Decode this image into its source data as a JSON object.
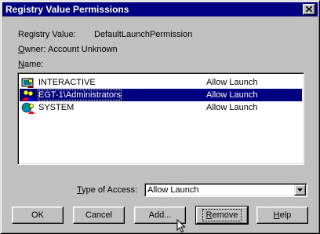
{
  "window": {
    "title": "Registry Value Permissions"
  },
  "fields": {
    "registry_value_label": "Registry Value:",
    "registry_value": "DefaultLaunchPermission",
    "owner_label_underlined": "O",
    "owner_label_rest": "wner:",
    "owner_value": "Account Unknown",
    "name_label_underlined": "N",
    "name_label_rest": "ame:"
  },
  "permissions": [
    {
      "name": "INTERACTIVE",
      "access": "Allow Launch",
      "icon": "users-icon",
      "selected": false
    },
    {
      "name": "EGT-1\\Administrators",
      "access": "Allow Launch",
      "icon": "group-icon",
      "selected": true
    },
    {
      "name": "SYSTEM",
      "access": "Allow Launch",
      "icon": "globe-user-icon",
      "selected": false
    }
  ],
  "type_of_access": {
    "label_underlined": "T",
    "label_rest": "ype of Access:",
    "value": "Allow Launch"
  },
  "buttons": {
    "ok": "OK",
    "cancel": "Cancel",
    "add": "Add...",
    "remove_underlined": "R",
    "remove_rest": "emove",
    "help_underlined": "H",
    "help_rest": "elp"
  },
  "colors": {
    "face": "#c0c0c0",
    "title_bar": "#000080",
    "selection": "#000080"
  }
}
